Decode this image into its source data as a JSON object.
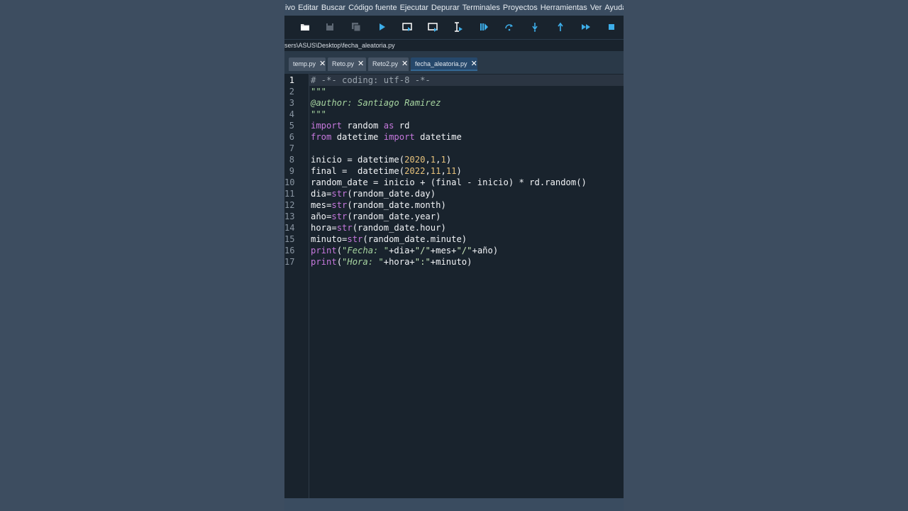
{
  "menu": [
    "ivo",
    "Editar",
    "Buscar",
    "Código fuente",
    "Ejecutar",
    "Depurar",
    "Terminales",
    "Proyectos",
    "Herramientas",
    "Ver",
    "Ayuda"
  ],
  "toolbar": {
    "icons": [
      "open-folder-icon",
      "save-icon",
      "save-all-icon",
      "run-icon",
      "run-cell-icon",
      "run-cell-advance-icon",
      "run-selection-icon",
      "debug-icon",
      "step-over-icon",
      "step-into-icon",
      "step-return-icon",
      "continue-icon",
      "stop-icon"
    ],
    "accent": "#3daee9"
  },
  "path": "sers\\ASUS\\Desktop\\fecha_aleatoria.py",
  "tabs": [
    {
      "label": "temp.py",
      "active": false
    },
    {
      "label": "Reto.py",
      "active": false
    },
    {
      "label": "Reto2.py",
      "active": false
    },
    {
      "label": "fecha_aleatoria.py",
      "active": true
    }
  ],
  "editor": {
    "current_line": 1,
    "line_numbers": [
      "1",
      "2",
      "3",
      "4",
      "5",
      "6",
      "7",
      "8",
      "9",
      "10",
      "11",
      "12",
      "13",
      "14",
      "15",
      "16",
      "17"
    ],
    "code": {
      "l1": "# -*- coding: utf-8 -*-",
      "l2": "\"\"\"",
      "l3": "@author: Santiago Ramirez",
      "l4": "\"\"\"",
      "l5a": "import",
      "l5b": " random ",
      "l5c": "as",
      "l5d": " rd",
      "l6a": "from",
      "l6b": " datetime ",
      "l6c": "import",
      "l6d": " datetime",
      "l8a": "inicio = datetime(",
      "l8b": "2020",
      "l8c": ",",
      "l8d": "1",
      "l8e": ",",
      "l8f": "1",
      "l8g": ")",
      "l9a": "final =  datetime(",
      "l9b": "2022",
      "l9c": ",",
      "l9d": "11",
      "l9e": ",",
      "l9f": "11",
      "l9g": ")",
      "l10": "random_date = inicio + (final - inicio) * rd.random()",
      "l11a": "dia=",
      "l11b": "str",
      "l11c": "(random_date.day)",
      "l12a": "mes=",
      "l12b": "str",
      "l12c": "(random_date.month)",
      "l13a": "año=",
      "l13b": "str",
      "l13c": "(random_date.year)",
      "l14a": "hora=",
      "l14b": "str",
      "l14c": "(random_date.hour)",
      "l15a": "minuto=",
      "l15b": "str",
      "l15c": "(random_date.minute)",
      "l16a": "print",
      "l16b": "(",
      "l16c": "\"Fecha: \"",
      "l16d": "+dia+",
      "l16e": "\"/\"",
      "l16f": "+mes+",
      "l16g": "\"/\"",
      "l16h": "+año)",
      "l17a": "print",
      "l17b": "(",
      "l17c": "\"Hora: \"",
      "l17d": "+hora+",
      "l17e": "\":\"",
      "l17f": "+minuto)"
    }
  }
}
